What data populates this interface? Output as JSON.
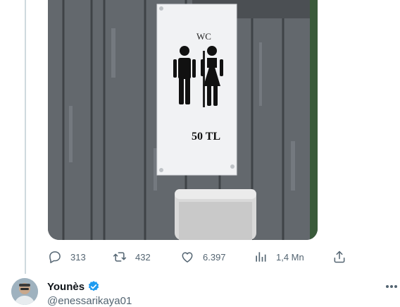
{
  "media": {
    "sign_title": "WC",
    "sign_price": "50 TL"
  },
  "actions": {
    "replies": "313",
    "retweets": "432",
    "likes": "6.397",
    "views": "1,4 Mn"
  },
  "next_tweet": {
    "name": "Younès",
    "handle": "@enessarikaya01"
  }
}
